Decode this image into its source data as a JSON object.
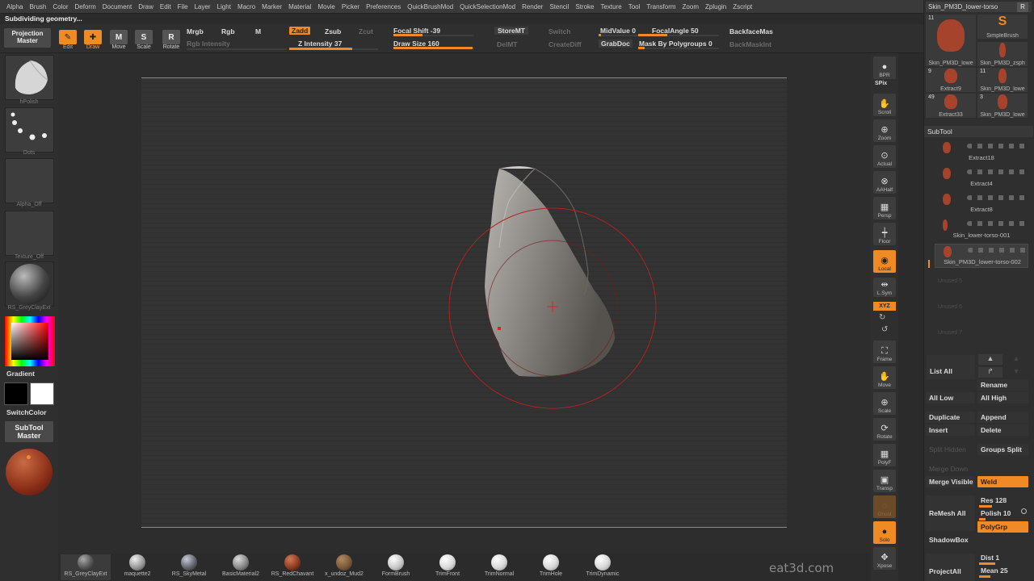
{
  "menu": [
    "Alpha",
    "Brush",
    "Color",
    "Deform",
    "Document",
    "Draw",
    "Edit",
    "File",
    "Layer",
    "Light",
    "Macro",
    "Marker",
    "Material",
    "Movie",
    "Picker",
    "Preferences",
    "QuickBrushMod",
    "QuickSelectionMod",
    "Render",
    "Stencil",
    "Stroke",
    "Texture",
    "Tool",
    "Transform",
    "Zoom",
    "Zplugin",
    "Zscript"
  ],
  "status": "Subdividing geometry...",
  "topbar": {
    "projection_master": "Projection Master",
    "edit": "Edit",
    "draw": "Draw",
    "move": "Move",
    "scale": "Scale",
    "rotate": "Rotate",
    "mrgb": "Mrgb",
    "rgb": "Rgb",
    "m": "M",
    "rgb_intensity": "Rgb Intensity",
    "zadd": "Zadd",
    "zsub": "Zsub",
    "zcut": "Zcut",
    "z_intensity": "Z Intensity 37",
    "focal_shift": "Focal Shift -39",
    "draw_size": "Draw Size 160",
    "storemt": "StoreMT",
    "delmt": "DelMT",
    "switch": "Switch",
    "creatediff": "CreateDiff",
    "midvalue": "MidValue 0",
    "grabdoc": "GrabDoc",
    "focalangle": "FocalAngle 50",
    "mask_polygroups": "Mask By Polygroups 0",
    "backfacemask": "BackfaceMas",
    "backmaskint": "BackMaskInt"
  },
  "left": {
    "brush_label": "hPolish",
    "stroke_label": "Dots",
    "alpha_label": "Alpha_Off",
    "texture_label": "Texture_Off",
    "material_label": "RS_GreyClayExt",
    "gradient": "Gradient",
    "switchcolor": "SwitchColor",
    "subtool_master": "SubTool Master"
  },
  "shelf": [
    "BPR",
    "SPix",
    "Scroll",
    "Zoom",
    "Actual",
    "AAHalf",
    "Persp",
    "Floor",
    "Local",
    "L.Sym",
    "XYZ",
    "Frame",
    "Move",
    "Scale",
    "Rotate",
    "PolyF",
    "Transp",
    "Ghost",
    "Solo",
    "Xpose"
  ],
  "right": {
    "title": "Skin_PM3D_lower-torso",
    "r_btn": "R",
    "tools": [
      {
        "num": "11",
        "cap": "Skin_PM3D_lowe"
      },
      {
        "num": "",
        "cap": "SimpleBrush"
      },
      {
        "num": "",
        "cap": "Skin_PM3D_zsph"
      },
      {
        "num": "9",
        "cap": "Extract9"
      },
      {
        "num": "11",
        "cap": "Skin_PM3D_lowe"
      },
      {
        "num": "49",
        "cap": "Extract33"
      },
      {
        "num": "3",
        "cap": "Skin_PM3D_lowe"
      }
    ],
    "subtool_title": "SubTool",
    "subtools": [
      "Extract18",
      "Extract4",
      "Extract8",
      "Skin_lower-torso-001",
      "Skin_PM3D_lower-torso-002"
    ],
    "unused": [
      "Unused 5",
      "Unused 6",
      "Unused 7"
    ],
    "list_all": "List All",
    "rename": "Rename",
    "all_low": "All Low",
    "all_high": "All High",
    "duplicate": "Duplicate",
    "append": "Append",
    "insert": "Insert",
    "delete": "Delete",
    "split_hidden": "Split Hidden",
    "groups_split": "Groups Split",
    "merge_down": "Merge Down",
    "merge_visible": "Merge Visible",
    "weld": "Weld",
    "remesh_all": "ReMesh All",
    "res": "Res 128",
    "polish": "Polish 10",
    "polygrp": "PolyGrp",
    "shadowbox": "ShadowBox",
    "project_all": "ProjectAll",
    "dist": "Dist 1",
    "mean": "Mean 25"
  },
  "materials": [
    {
      "label": "RS_GreyClayExt",
      "color": "#5a5a5a"
    },
    {
      "label": "maquette2",
      "color": "#9a9a9a"
    },
    {
      "label": "RS_SkyMetal",
      "color": "#6a6f7a"
    },
    {
      "label": "BasicMaterial2",
      "color": "#8a8a8a"
    },
    {
      "label": "RS_RedChavant",
      "color": "#8e3c22"
    },
    {
      "label": "x_undoz_Mud2",
      "color": "#7a5a3a"
    },
    {
      "label": "FormBrush",
      "color": "#c8c8c8"
    },
    {
      "label": "TrimFront",
      "color": "#d8d8d8"
    },
    {
      "label": "TrimNormal",
      "color": "#d8d8d8"
    },
    {
      "label": "TrimHole",
      "color": "#d8d8d8"
    },
    {
      "label": "TrimDynamic",
      "color": "#d8d8d8"
    }
  ],
  "watermark": "eat3d.com",
  "accent": "#f08a24"
}
